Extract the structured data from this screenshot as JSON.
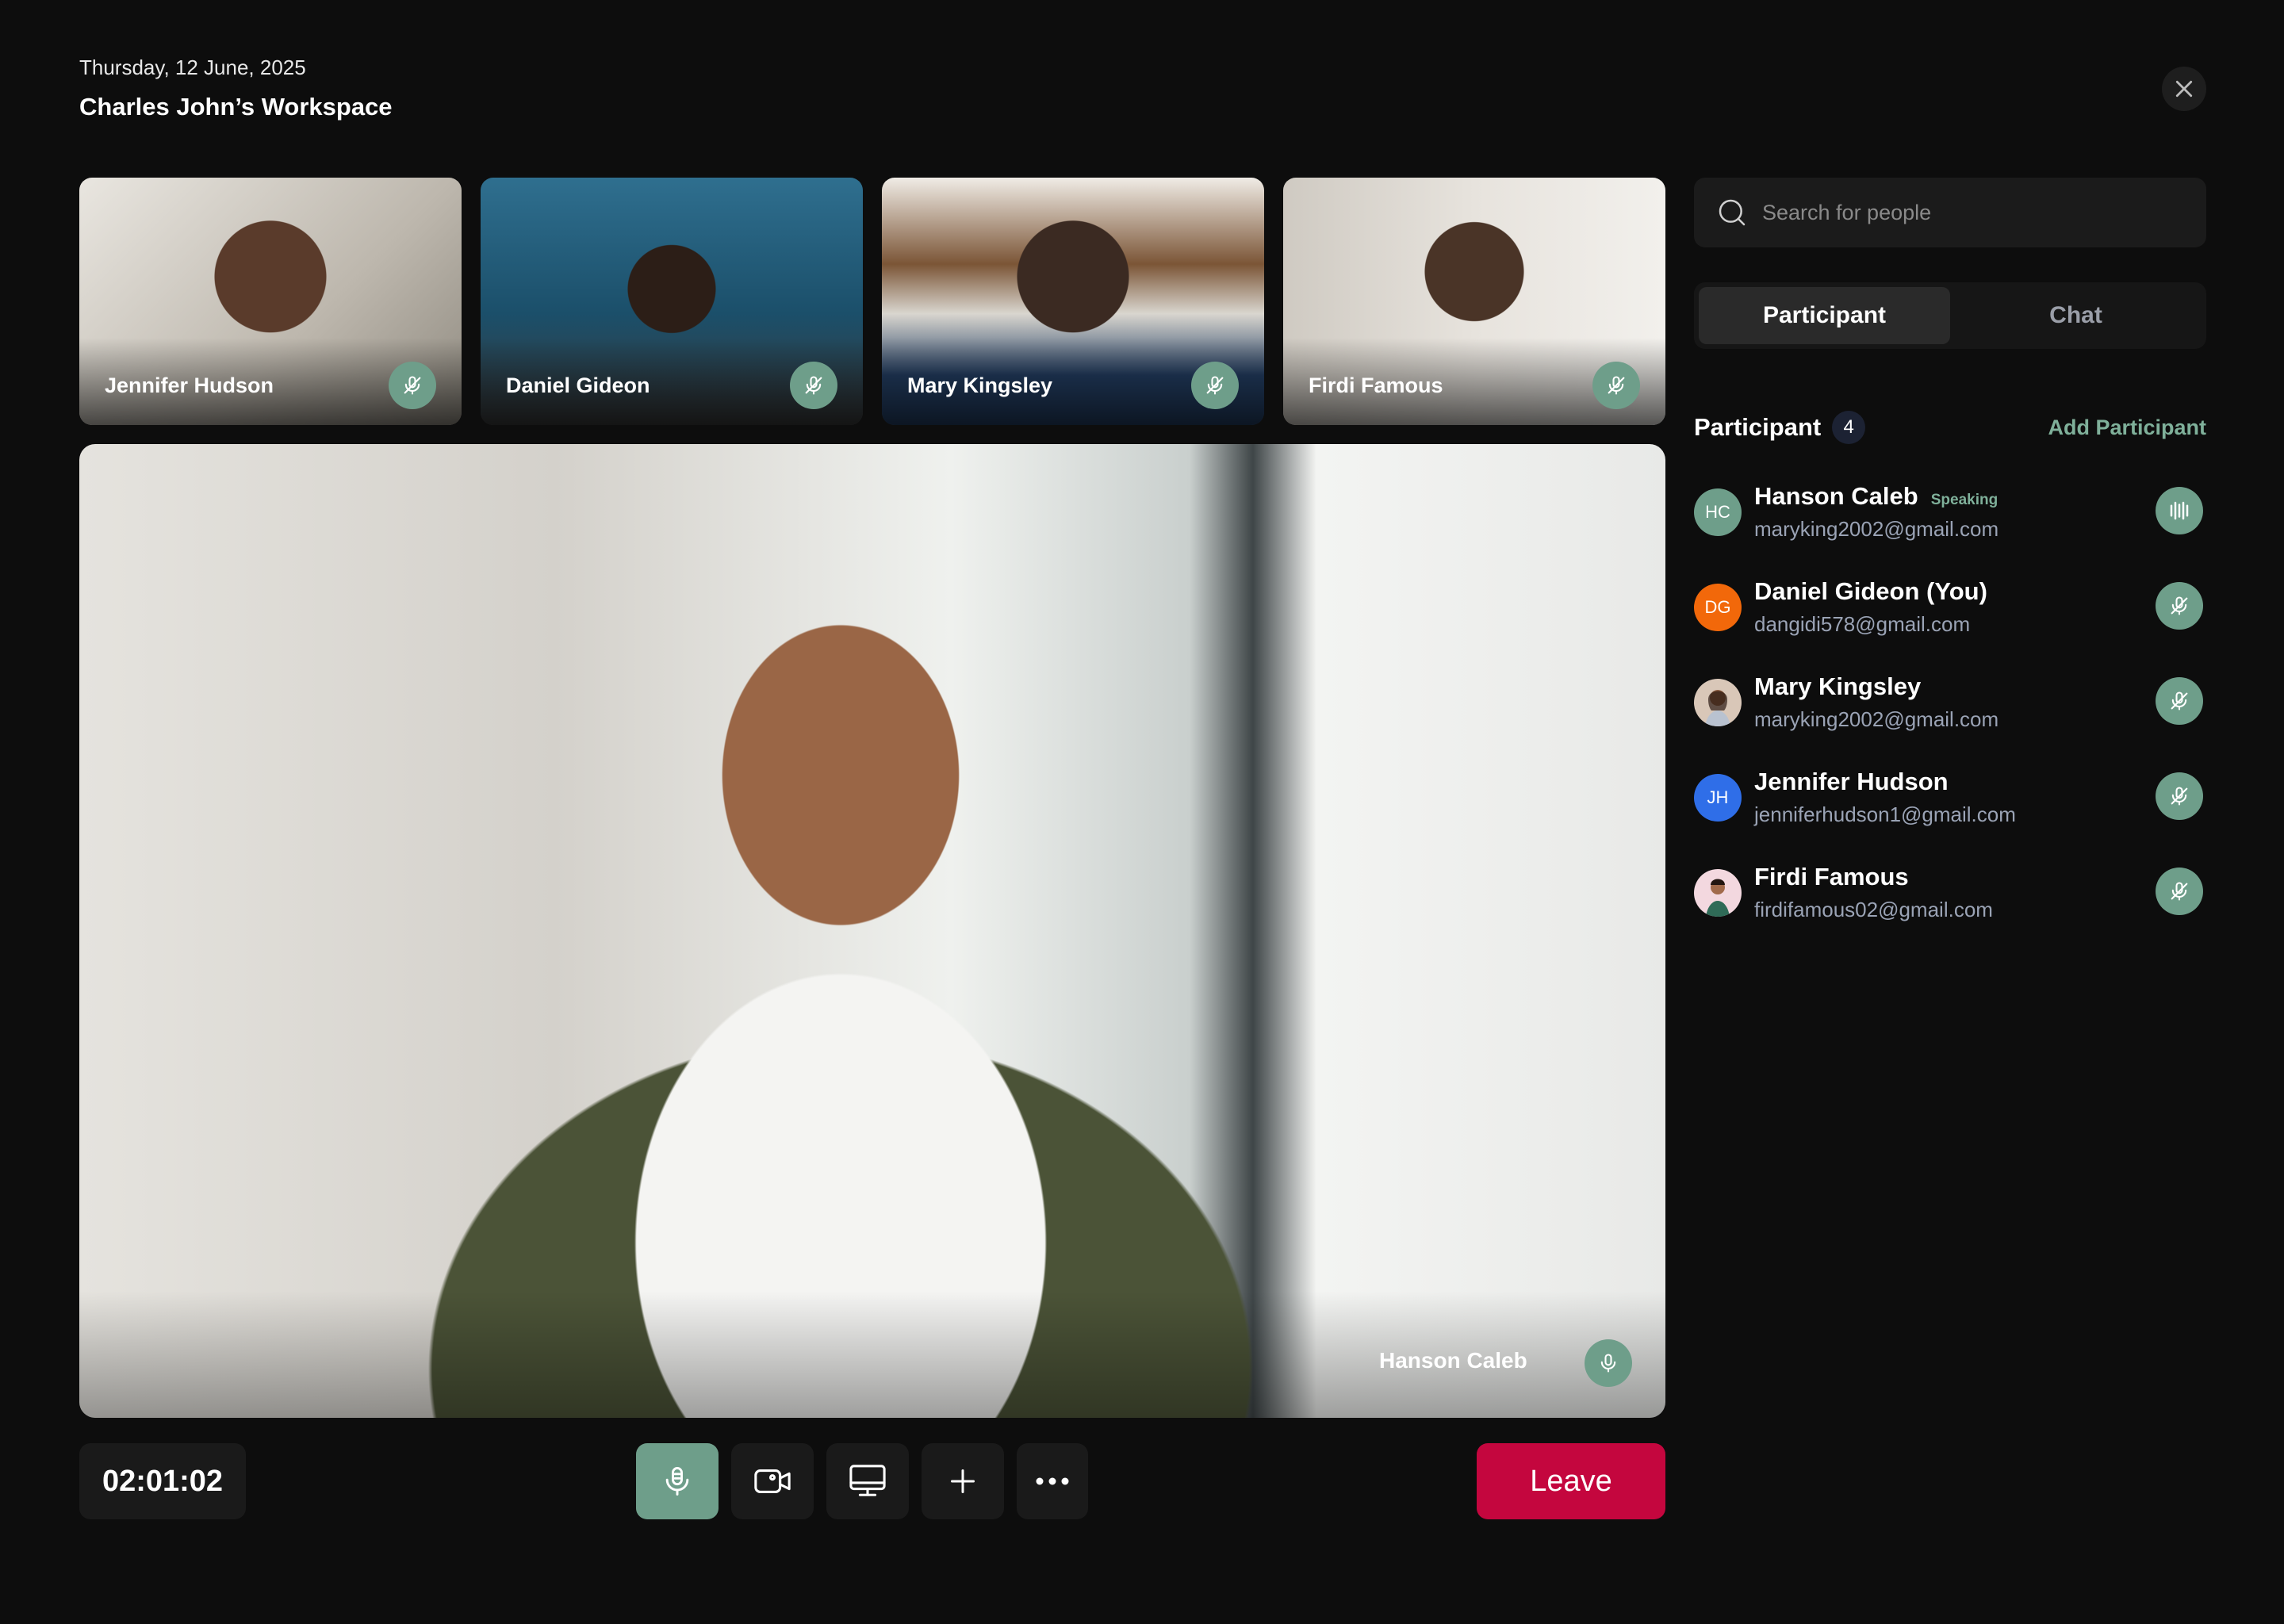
{
  "header": {
    "date": "Thursday, 12 June, 2025",
    "workspace": "Charles John’s Workspace"
  },
  "thumbnails": [
    {
      "name": "Jennifer Hudson",
      "mic": "mic-off-icon"
    },
    {
      "name": "Daniel Gideon",
      "mic": "mic-off-icon"
    },
    {
      "name": "Mary Kingsley",
      "mic": "mic-off-icon"
    },
    {
      "name": "Firdi Famous",
      "mic": "mic-off-icon"
    }
  ],
  "main_video": {
    "name": "Hanson Caleb",
    "mic": "mic-icon"
  },
  "controls": {
    "timer": "02:01:02",
    "leave_label": "Leave",
    "buttons": [
      "mic-icon",
      "video-camera-icon",
      "screen-share-icon",
      "plus-icon",
      "more-dots-icon"
    ]
  },
  "sidebar": {
    "search_placeholder": "Search for people",
    "tabs": [
      {
        "label": "Participant",
        "active": true
      },
      {
        "label": "Chat",
        "active": false
      }
    ],
    "participants_title": "Participant",
    "participants_count": "4",
    "add_label": "Add Participant",
    "people": [
      {
        "initials": "HC",
        "name": "Hanson Caleb",
        "status": "Speaking",
        "email": "maryking2002@gmail.com",
        "avatar_color": "#6e9e8a",
        "action": "audio-wave-icon"
      },
      {
        "initials": "DG",
        "name": "Daniel Gideon (You)",
        "status": "",
        "email": "dangidi578@gmail.com",
        "avatar_color": "#f2680a",
        "action": "mic-off-icon"
      },
      {
        "initials": "",
        "name": "Mary Kingsley",
        "status": "",
        "email": "maryking2002@gmail.com",
        "avatar_color": "#d9c7b8",
        "action": "mic-off-icon"
      },
      {
        "initials": "JH",
        "name": "Jennifer Hudson",
        "status": "",
        "email": "jenniferhudson1@gmail.com",
        "avatar_color": "#2f6ee8",
        "action": "mic-off-icon"
      },
      {
        "initials": "",
        "name": "Firdi Famous",
        "status": "",
        "email": "firdifamous02@gmail.com",
        "avatar_color": "#f3d8df",
        "action": "mic-off-icon"
      }
    ]
  },
  "colors": {
    "background": "#0d0d0d",
    "accent_green": "#6e9e8a",
    "leave_red": "#c4063e"
  }
}
